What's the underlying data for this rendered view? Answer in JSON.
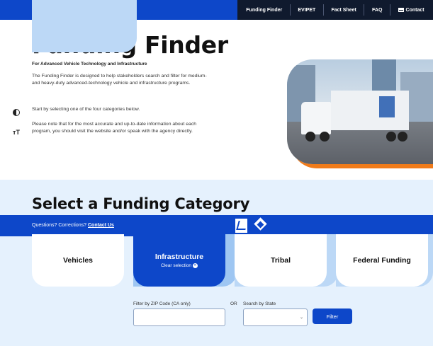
{
  "nav": {
    "items": [
      "Funding Finder",
      "EVIPET",
      "Fact Sheet",
      "FAQ",
      "Contact"
    ],
    "contact_icon": "mail-icon"
  },
  "hero": {
    "title": "Funding Finder",
    "subtitle": "For Advanced Vehicle Technology and Infrastructure",
    "p1": "The Funding Finder is designed to help stakeholders search and filter for medium- and heavy-duty advanced-technology vehicle and infrastructure programs.",
    "p2": "Start by selecting one of the four categories below.",
    "p3": "Please note that for the most accurate and up-to-date information about each program, you should visit the website and/or speak with the agency directly.",
    "tools": {
      "contrast": "contrast-icon",
      "text_size": "text-size-icon",
      "text_size_glyph": "тТ"
    }
  },
  "category": {
    "title": "Select a Funding Category",
    "questions": "Questions? Corrections?",
    "contact_link": "Contact Us",
    "cards": [
      {
        "label": "Vehicles"
      },
      {
        "label": "Infrastructure",
        "clear": "Clear selection"
      },
      {
        "label": "Tribal"
      },
      {
        "label": "Federal Funding"
      }
    ]
  },
  "filter": {
    "zip_label": "Filter by ZIP Code (CA only)",
    "or": "OR",
    "state_label": "Search by State",
    "zip_value": "",
    "state_value": "",
    "button": "Filter"
  },
  "colors": {
    "brand_blue": "#0d47c9",
    "nav_dark": "#101a2e",
    "section_bg": "#e5f1fd",
    "accent_orange": "#f07b1a"
  }
}
